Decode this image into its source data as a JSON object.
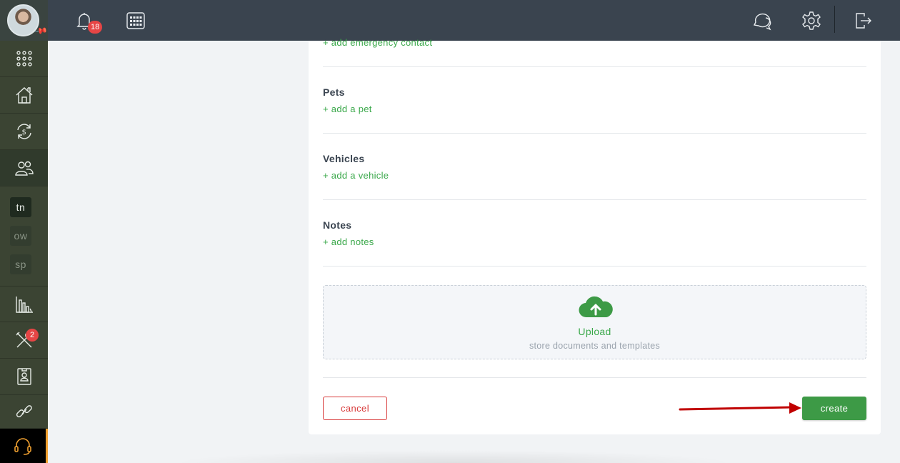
{
  "topbar": {
    "notification_count": "18"
  },
  "sidebar": {
    "chips": [
      "tn",
      "ow",
      "sp"
    ],
    "tools_badge": "2"
  },
  "form": {
    "emergency_link": "+ add emergency contact",
    "pets": {
      "title": "Pets",
      "link": "+ add a pet"
    },
    "vehicles": {
      "title": "Vehicles",
      "link": "+ add a vehicle"
    },
    "notes": {
      "title": "Notes",
      "link": "+ add notes"
    },
    "upload": {
      "label": "Upload",
      "sub": "store documents and templates"
    },
    "cancel_label": "cancel",
    "create_label": "create"
  },
  "colors": {
    "accent_green": "#3d9a46",
    "danger_red": "#d83a3a",
    "annotation_arrow": "#c00000"
  }
}
